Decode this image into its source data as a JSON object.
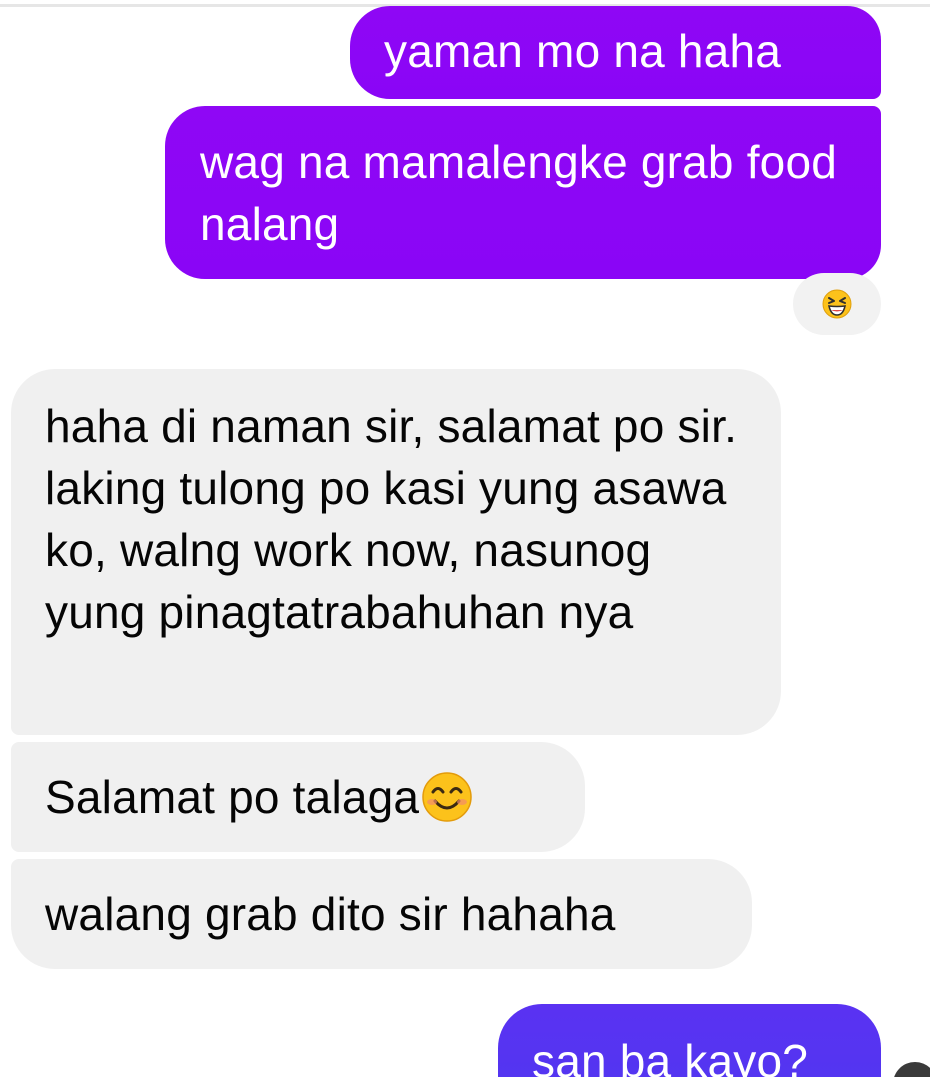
{
  "messages_sent": [
    {
      "text": "yaman mo na haha"
    },
    {
      "text": "wag na mamalengke grab food nalang"
    },
    {
      "text": "san ba kayo?"
    }
  ],
  "reaction": {
    "icon": "laughing-face-emoji"
  },
  "messages_received": [
    {
      "text": "haha di naman sir, salamat po sir. laking tulong po kasi yung asawa ko, walng work now, nasunog yung pinagtatrabahuhan nya"
    },
    {
      "text": "Salamat po talaga",
      "emoji": "smiling-face-emoji"
    },
    {
      "text": "walang grab dito sir hahaha"
    }
  ],
  "colors": {
    "sent_bubble": "#8a05f6",
    "sent_bubble_latest": "#5436f1",
    "received_bubble": "#f0f0f0",
    "received_text": "#050505",
    "sent_text": "#ffffff"
  }
}
